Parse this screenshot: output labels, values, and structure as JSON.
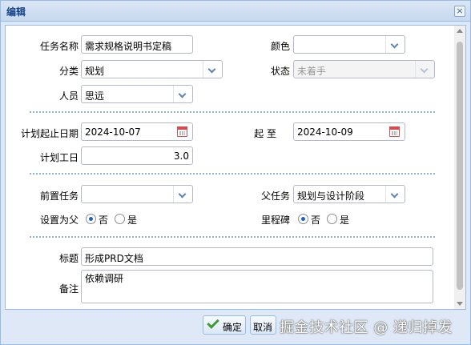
{
  "window": {
    "title": "编辑",
    "close_glyph": "×"
  },
  "row1": {
    "task_name_label": "任务名称",
    "task_name_value": "需求规格说明书定稿",
    "color_label": "颜色",
    "color_value": ""
  },
  "row2": {
    "category_label": "分类",
    "category_value": "规划",
    "status_label": "状态",
    "status_value": "未着手"
  },
  "row3": {
    "person_label": "人员",
    "person_value": "思远"
  },
  "dates": {
    "plan_start_label": "计划起止日期",
    "start_value": "2024-10-07",
    "to_label": "起 至",
    "end_value": "2024-10-09",
    "workdays_label": "计划工日",
    "workdays_value": "3.0"
  },
  "relations": {
    "pre_task_label": "前置任务",
    "pre_task_value": "",
    "parent_task_label": "父任务",
    "parent_task_value": "规划与设计阶段",
    "set_parent_label": "设置为父",
    "set_parent_options": [
      "否",
      "是"
    ],
    "set_parent_selected": "否",
    "milestone_label": "里程碑",
    "milestone_options": [
      "否",
      "是"
    ],
    "milestone_selected": "否"
  },
  "detail": {
    "title_label": "标题",
    "title_value": "形成PRD文档",
    "note_label": "备注",
    "note_value": "依赖调研"
  },
  "buttons": {
    "ok_label": "确定",
    "cancel_label": "取消"
  },
  "watermark": "掘金技术社区 @ 递归掉发",
  "colors": {
    "accent": "#15428b",
    "border": "#99bbe8",
    "separator": "#8fb0d9"
  }
}
